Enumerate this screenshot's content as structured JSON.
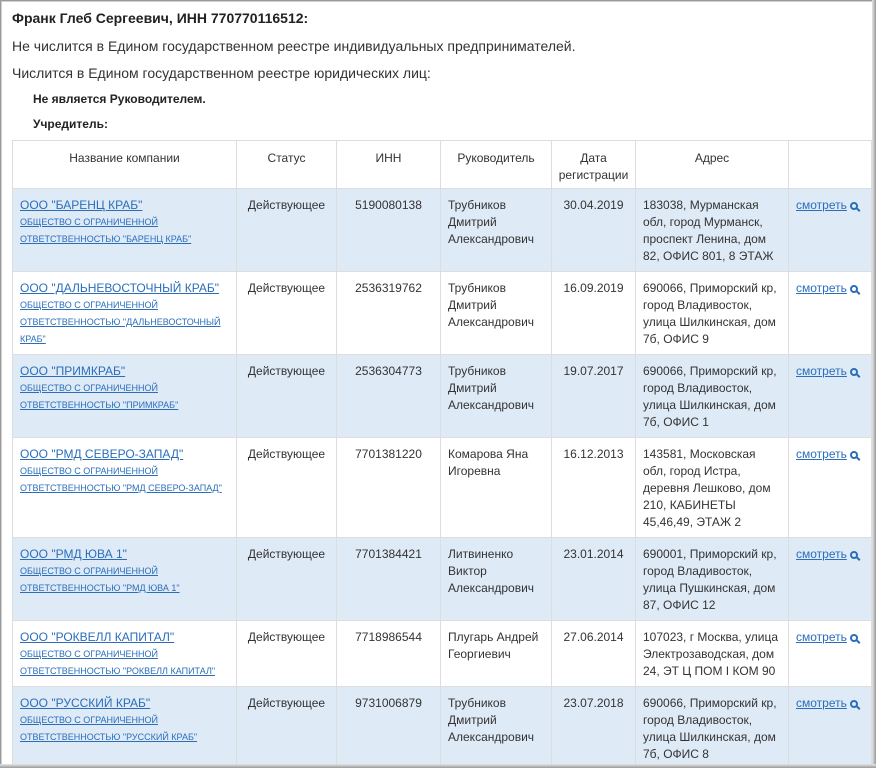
{
  "header": {
    "person": "Франк Глеб Сергеевич, ИНН 770770116512:",
    "line1": "Не числится в Едином государственном реестре индивидуальных предпринимателей.",
    "line2": "Числится в Едином государственном реестре юридических лиц:",
    "role_not_head": "Не является Руководителем.",
    "role_founder": "Учредитель:"
  },
  "table": {
    "columns": [
      "Название компании",
      "Статус",
      "ИНН",
      "Руководитель",
      "Дата регистрации",
      "Адрес",
      ""
    ],
    "view_label": "смотреть",
    "rows": [
      {
        "name": "ООО \"БАРЕНЦ КРАБ\"",
        "full": "общество с ограниченной ответственностью \"БАРЕНЦ КРАБ\"",
        "status": "Действующее",
        "inn": "5190080138",
        "head": "Трубников Дмитрий Александрович",
        "date": "30.04.2019",
        "address": "183038, Мурманская обл, город Мурманск, проспект Ленина, дом 82, ОФИС 801, 8 ЭТАЖ"
      },
      {
        "name": "ООО \"ДАЛЬНЕВОСТОЧНЫЙ КРАБ\"",
        "full": "общество с ограниченной ответственностью \"ДАЛЬНЕВОСТОЧНЫЙ КРАБ\"",
        "status": "Действующее",
        "inn": "2536319762",
        "head": "Трубников Дмитрий Александрович",
        "date": "16.09.2019",
        "address": "690066, Приморский кр, город Владивосток, улица Шилкинская, дом 7б, ОФИС 9"
      },
      {
        "name": "ООО \"ПРИМКРАБ\"",
        "full": "общество с ограниченной ответственностью \"ПРИМКРАБ\"",
        "status": "Действующее",
        "inn": "2536304773",
        "head": "Трубников Дмитрий Александрович",
        "date": "19.07.2017",
        "address": "690066, Приморский кр, город Владивосток, улица Шилкинская, дом 7б, ОФИС 1"
      },
      {
        "name": "ООО \"РМД СЕВЕРО-ЗАПАД\"",
        "full": "общество с ограниченной ответственностью \"РМД СЕВЕРО-ЗАПАД\"",
        "status": "Действующее",
        "inn": "7701381220",
        "head": "Комарова Яна Игоревна",
        "date": "16.12.2013",
        "address": "143581, Московская обл, город Истра, деревня Лешково, дом 210, КАБИНЕТЫ 45,46,49, ЭТАЖ 2"
      },
      {
        "name": "ООО \"РМД ЮВА 1\"",
        "full": "общество с ограниченной ответственностью \"РМД ЮВА 1\"",
        "status": "Действующее",
        "inn": "7701384421",
        "head": "Литвиненко Виктор Александрович",
        "date": "23.01.2014",
        "address": "690001, Приморский кр, город Владивосток, улица Пушкинская, дом 87, ОФИС 12"
      },
      {
        "name": "ООО \"РОКВЕЛЛ КАПИТАЛ\"",
        "full": "общество с ограниченной ответственностью \"РОКВЕЛЛ КАПИТАЛ\"",
        "status": "Действующее",
        "inn": "7718986544",
        "head": "Плугарь Андрей Георгиевич",
        "date": "27.06.2014",
        "address": "107023, г Москва, улица Электрозаводская, дом 24, ЭТ Ц ПОМ I КОМ 90"
      },
      {
        "name": "ООО \"РУССКИЙ КРАБ\"",
        "full": "общество с ограниченной ответственностью \"РУССКИЙ КРАБ\"",
        "status": "Действующее",
        "inn": "9731006879",
        "head": "Трубников Дмитрий Александрович",
        "date": "23.07.2018",
        "address": "690066, Приморский кр, город Владивосток, улица Шилкинская, дом 7б, ОФИС 8"
      }
    ]
  }
}
